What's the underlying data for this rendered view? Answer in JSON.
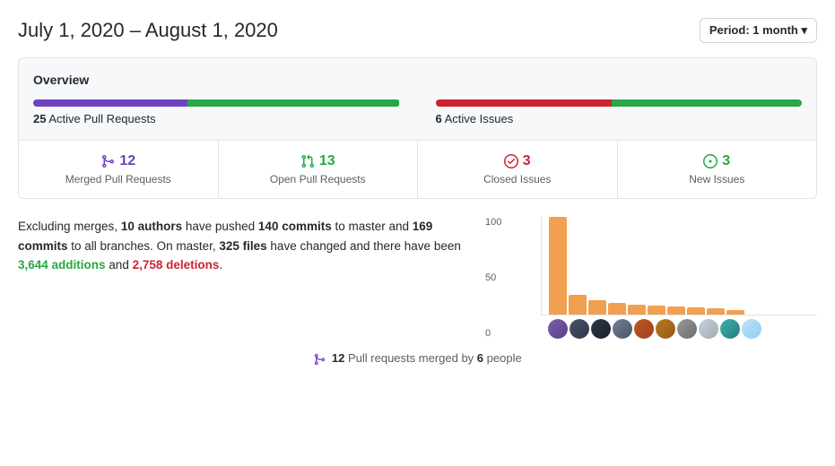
{
  "header": {
    "date_range": "July 1, 2020 – August 1, 2020",
    "period_label": "Period:",
    "period_value": "1 month",
    "period_arrow": "▾"
  },
  "overview": {
    "title": "Overview",
    "pull_requests": {
      "count": "25",
      "label": "Active Pull Requests",
      "bar1_color": "#6f42c1",
      "bar1_width": "42",
      "bar2_color": "#28a745",
      "bar2_width": "58"
    },
    "issues": {
      "count": "6",
      "label": "Active Issues",
      "bar1_color": "#cb2431",
      "bar1_width": "48",
      "bar2_color": "#28a745",
      "bar2_width": "52"
    }
  },
  "counts": [
    {
      "icon": "⑂",
      "icon_class": "icon-merged",
      "value": "12",
      "desc": "Merged Pull Requests"
    },
    {
      "icon": "⇅",
      "icon_class": "icon-open-pr",
      "value": "13",
      "desc": "Open Pull Requests"
    },
    {
      "icon": "◷",
      "icon_class": "icon-closed-issue",
      "value": "3",
      "desc": "Closed Issues"
    },
    {
      "icon": "ℹ",
      "icon_class": "icon-new-issue",
      "value": "3",
      "desc": "New Issues"
    }
  ],
  "commits_text": {
    "prefix": "Excluding merges, ",
    "authors_count": "10 authors",
    "mid1": " have pushed ",
    "commits_master": "140 commits",
    "mid2": " to master and ",
    "commits_all": "169 commits",
    "mid3": " to all branches. On master, ",
    "files_changed": "325 files",
    "mid4": " have changed and there have been ",
    "additions": "3,644 additions",
    "mid5": " and ",
    "deletions": "2,758 deletions",
    "suffix": "."
  },
  "chart": {
    "y_labels": [
      "100",
      "50",
      "0"
    ],
    "bars": [
      {
        "height": 100,
        "color": "#f0a050"
      },
      {
        "height": 20,
        "color": "#f0a050"
      },
      {
        "height": 15,
        "color": "#f0a050"
      },
      {
        "height": 12,
        "color": "#f0a050"
      },
      {
        "height": 10,
        "color": "#f0a050"
      },
      {
        "height": 9,
        "color": "#f0a050"
      },
      {
        "height": 8,
        "color": "#f0a050"
      },
      {
        "height": 7,
        "color": "#f0a050"
      },
      {
        "height": 6,
        "color": "#f0a050"
      },
      {
        "height": 5,
        "color": "#f0a050"
      }
    ],
    "avatars": [
      {
        "class": "av1"
      },
      {
        "class": "av2"
      },
      {
        "class": "av3"
      },
      {
        "class": "av4"
      },
      {
        "class": "av5"
      },
      {
        "class": "av6"
      },
      {
        "class": "av7"
      },
      {
        "class": "av8"
      },
      {
        "class": "av9"
      },
      {
        "class": "av10"
      }
    ]
  },
  "footer": {
    "icon": "⑂",
    "pr_count": "12",
    "text1": " Pull requests merged by ",
    "people_count": "6",
    "text2": " people"
  }
}
